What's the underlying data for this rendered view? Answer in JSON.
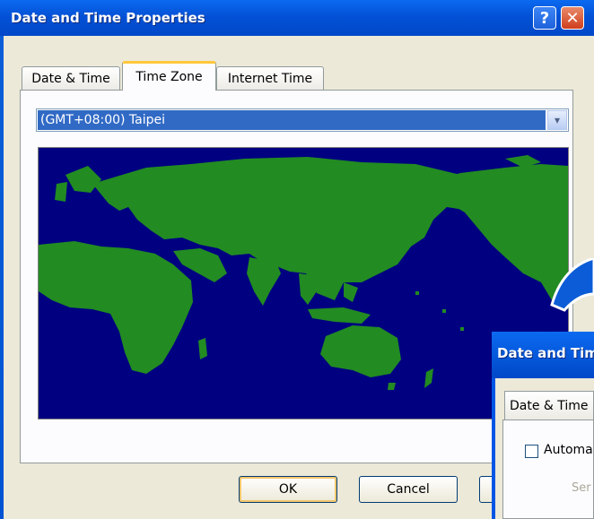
{
  "window": {
    "title": "Date and Time Properties",
    "help_label": "?",
    "close_label": "✕"
  },
  "tabs": [
    {
      "label": "Date & Time",
      "active": false
    },
    {
      "label": "Time Zone",
      "active": true
    },
    {
      "label": "Internet Time",
      "active": false
    }
  ],
  "timezone": {
    "selected": "(GMT+08:00) Taipei",
    "arrow": "▾"
  },
  "map": {
    "ocean_color": "#000080",
    "land_color": "#228b22"
  },
  "buttons": {
    "ok": "OK",
    "cancel": "Cancel"
  },
  "overlay": {
    "title": "Date and Time",
    "tab": "Date & Time",
    "checkbox_label": "Automa",
    "server_label": "Ser"
  }
}
